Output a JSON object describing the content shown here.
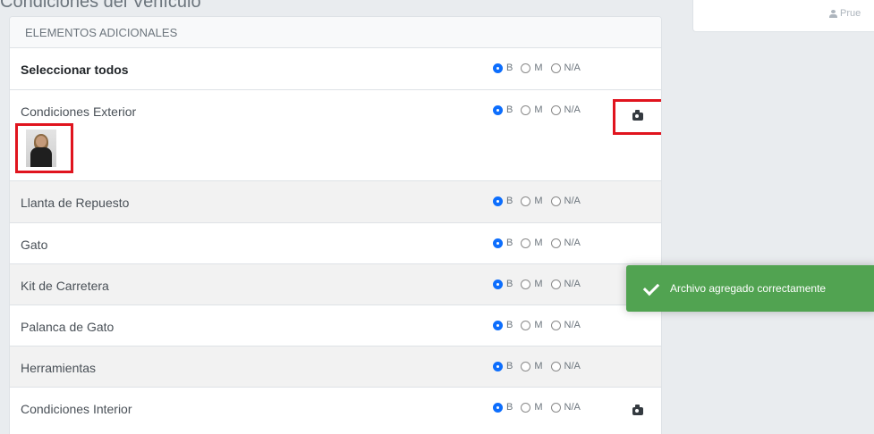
{
  "page": {
    "top_fragment": "Condiciones del Vehículo"
  },
  "top_card": {
    "text": "Prue",
    "icon": "user-icon"
  },
  "panel": {
    "title": "ELEMENTOS ADICIONALES",
    "radio_options": [
      "B",
      "M",
      "N/A"
    ],
    "rows": [
      {
        "label": "Seleccionar todos",
        "selected": "B",
        "bold": true
      },
      {
        "label": "Condiciones Exterior",
        "selected": "B",
        "camera": "camera-icon",
        "thumbnail": true
      },
      {
        "label": "Llanta de Repuesto",
        "selected": "B"
      },
      {
        "label": "Gato",
        "selected": "B"
      },
      {
        "label": "Kit de Carretera",
        "selected": "B"
      },
      {
        "label": "Palanca de Gato",
        "selected": "B"
      },
      {
        "label": "Herramientas",
        "selected": "B"
      },
      {
        "label": "Condiciones Interior",
        "selected": "B",
        "camera": "camera-icon"
      }
    ]
  },
  "toast": {
    "message": "Archivo agregado correctamente",
    "icon": "check-icon",
    "color": "#51a351"
  },
  "colors": {
    "accent": "#0d6efd",
    "highlight_box": "#e0141e"
  }
}
